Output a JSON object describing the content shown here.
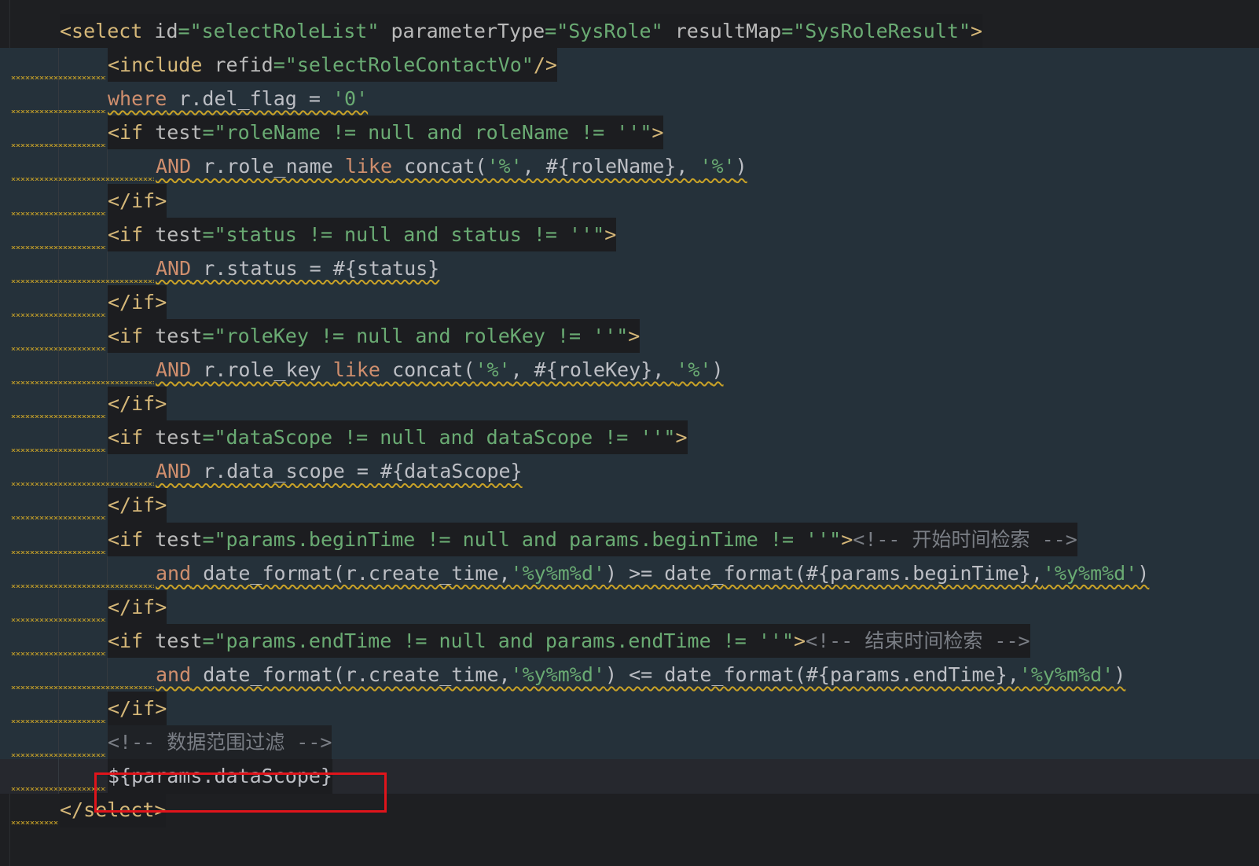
{
  "editor": {
    "language": "xml",
    "highlight_color": "#e0141b",
    "lines": [
      {
        "indent": 1,
        "tokens": [
          [
            "<select ",
            "t"
          ],
          [
            "id",
            "a"
          ],
          [
            "=\"selectRoleList\" ",
            "s"
          ],
          [
            "parameterType",
            "a"
          ],
          [
            "=\"SysRole\" ",
            "s"
          ],
          [
            "resultMap",
            "a"
          ],
          [
            "=\"SysRoleResult\"",
            "s"
          ],
          [
            ">",
            "t"
          ]
        ]
      },
      {
        "indent": 2,
        "tokens": [
          [
            "<include ",
            "t"
          ],
          [
            "refid",
            "a"
          ],
          [
            "=\"selectRoleContactVo\"",
            "s"
          ],
          [
            "/>",
            "t"
          ]
        ]
      },
      {
        "indent": 2,
        "tokens": [
          [
            "where",
            "k"
          ],
          [
            " r.del_flag = ",
            "p"
          ],
          [
            "'0'",
            "s"
          ]
        ]
      },
      {
        "indent": 2,
        "tokens": [
          [
            "<if ",
            "t"
          ],
          [
            "test",
            "a"
          ],
          [
            "=\"roleName != null and roleName != ''\"",
            "s"
          ],
          [
            ">",
            "t"
          ]
        ]
      },
      {
        "indent": 3,
        "tokens": [
          [
            "AND",
            "k"
          ],
          [
            " r.role_name ",
            "p"
          ],
          [
            "like",
            "k"
          ],
          [
            " concat(",
            "p"
          ],
          [
            "'%'",
            "s"
          ],
          [
            ", #{roleName}, ",
            "p"
          ],
          [
            "'%'",
            "s"
          ],
          [
            ")",
            "p"
          ]
        ]
      },
      {
        "indent": 2,
        "tokens": [
          [
            "</if>",
            "t"
          ]
        ]
      },
      {
        "indent": 2,
        "tokens": [
          [
            "<if ",
            "t"
          ],
          [
            "test",
            "a"
          ],
          [
            "=\"status != null and status != ''\"",
            "s"
          ],
          [
            ">",
            "t"
          ]
        ]
      },
      {
        "indent": 3,
        "tokens": [
          [
            "AND",
            "k"
          ],
          [
            " r.status = #{status}",
            "p"
          ]
        ]
      },
      {
        "indent": 2,
        "tokens": [
          [
            "</if>",
            "t"
          ]
        ]
      },
      {
        "indent": 2,
        "tokens": [
          [
            "<if ",
            "t"
          ],
          [
            "test",
            "a"
          ],
          [
            "=\"roleKey != null and roleKey != ''\"",
            "s"
          ],
          [
            ">",
            "t"
          ]
        ]
      },
      {
        "indent": 3,
        "tokens": [
          [
            "AND",
            "k"
          ],
          [
            " r.role_key ",
            "p"
          ],
          [
            "like",
            "k"
          ],
          [
            " concat(",
            "p"
          ],
          [
            "'%'",
            "s"
          ],
          [
            ", #{roleKey}, ",
            "p"
          ],
          [
            "'%'",
            "s"
          ],
          [
            ")",
            "p"
          ]
        ]
      },
      {
        "indent": 2,
        "tokens": [
          [
            "</if>",
            "t"
          ]
        ]
      },
      {
        "indent": 2,
        "tokens": [
          [
            "<if ",
            "t"
          ],
          [
            "test",
            "a"
          ],
          [
            "=\"dataScope != null and dataScope != ''\"",
            "s"
          ],
          [
            ">",
            "t"
          ]
        ]
      },
      {
        "indent": 3,
        "tokens": [
          [
            "AND",
            "k"
          ],
          [
            " r.data_scope = #{dataScope}",
            "p"
          ]
        ]
      },
      {
        "indent": 2,
        "tokens": [
          [
            "</if>",
            "t"
          ]
        ]
      },
      {
        "indent": 2,
        "tokens": [
          [
            "<if ",
            "t"
          ],
          [
            "test",
            "a"
          ],
          [
            "=\"params.beginTime != null and params.beginTime != ''\"",
            "s"
          ],
          [
            ">",
            "t"
          ],
          [
            "<!-- 开始时间检索 -->",
            "c"
          ]
        ]
      },
      {
        "indent": 3,
        "tokens": [
          [
            "and",
            "k"
          ],
          [
            " date_format(r.create_time,",
            "p"
          ],
          [
            "'%y%m%d'",
            "s"
          ],
          [
            ") >= date_format(#{params.beginTime},",
            "p"
          ],
          [
            "'%y%m%d'",
            "s"
          ],
          [
            ")",
            "p"
          ]
        ]
      },
      {
        "indent": 2,
        "tokens": [
          [
            "</if>",
            "t"
          ]
        ]
      },
      {
        "indent": 2,
        "tokens": [
          [
            "<if ",
            "t"
          ],
          [
            "test",
            "a"
          ],
          [
            "=\"params.endTime != null and params.endTime != ''\"",
            "s"
          ],
          [
            ">",
            "t"
          ],
          [
            "<!-- 结束时间检索 -->",
            "c"
          ]
        ]
      },
      {
        "indent": 3,
        "tokens": [
          [
            "and",
            "k"
          ],
          [
            " date_format(r.create_time,",
            "p"
          ],
          [
            "'%y%m%d'",
            "s"
          ],
          [
            ") <= date_format(#{params.endTime},",
            "p"
          ],
          [
            "'%y%m%d'",
            "s"
          ],
          [
            ")",
            "p"
          ]
        ]
      },
      {
        "indent": 2,
        "tokens": [
          [
            "</if>",
            "t"
          ]
        ]
      },
      {
        "indent": 2,
        "tokens": [
          [
            "<!-- 数据范围过滤 -->",
            "c"
          ]
        ]
      },
      {
        "indent": 2,
        "highlighted": true,
        "tokens": [
          [
            "${params.dataScope}",
            "p"
          ]
        ]
      },
      {
        "indent": 1,
        "tokens": [
          [
            "</select>",
            "t"
          ]
        ]
      }
    ]
  }
}
